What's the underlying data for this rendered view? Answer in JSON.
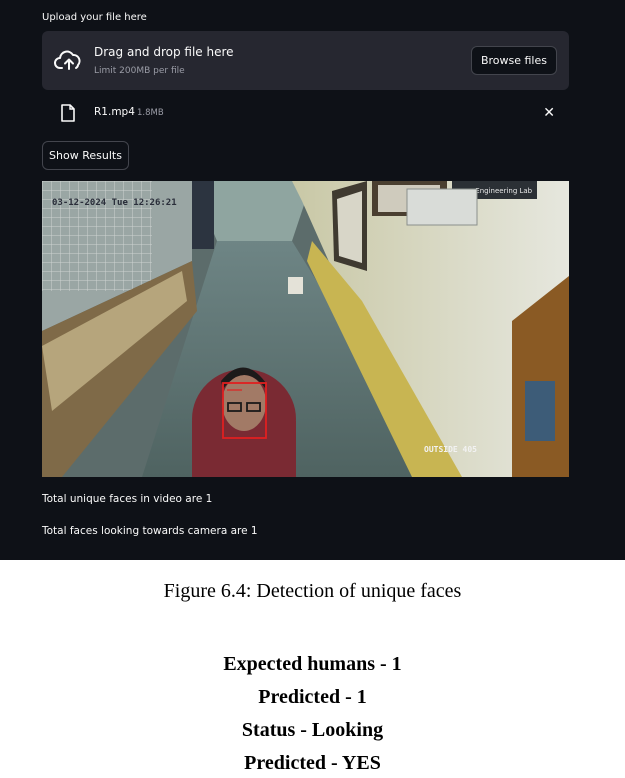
{
  "uploader": {
    "label": "Upload your file here",
    "drop_title": "Drag and drop file here",
    "limit": "Limit 200MB per file",
    "browse_label": "Browse files"
  },
  "file": {
    "name": "R1.mp4",
    "size": "1.8MB"
  },
  "show_results_label": "Show Results",
  "frame": {
    "timestamp": "03-12-2024 Tue 12:26:21",
    "camera_label": "OUTSIDE 405",
    "sign_text": "ware Engineering Lab"
  },
  "results": {
    "unique_faces": "Total unique faces in video are 1",
    "looking_faces": "Total faces looking towards camera are 1"
  },
  "caption": "Figure 6.4: Detection of unique faces",
  "summary": {
    "expected": "Expected humans - 1",
    "predicted": "Predicted - 1",
    "status": "Status - Looking",
    "predicted_yes": "Predicted - YES"
  },
  "colors": {
    "app_bg": "#0e1117",
    "panel_bg": "#262730",
    "box_color": "#e02020"
  }
}
